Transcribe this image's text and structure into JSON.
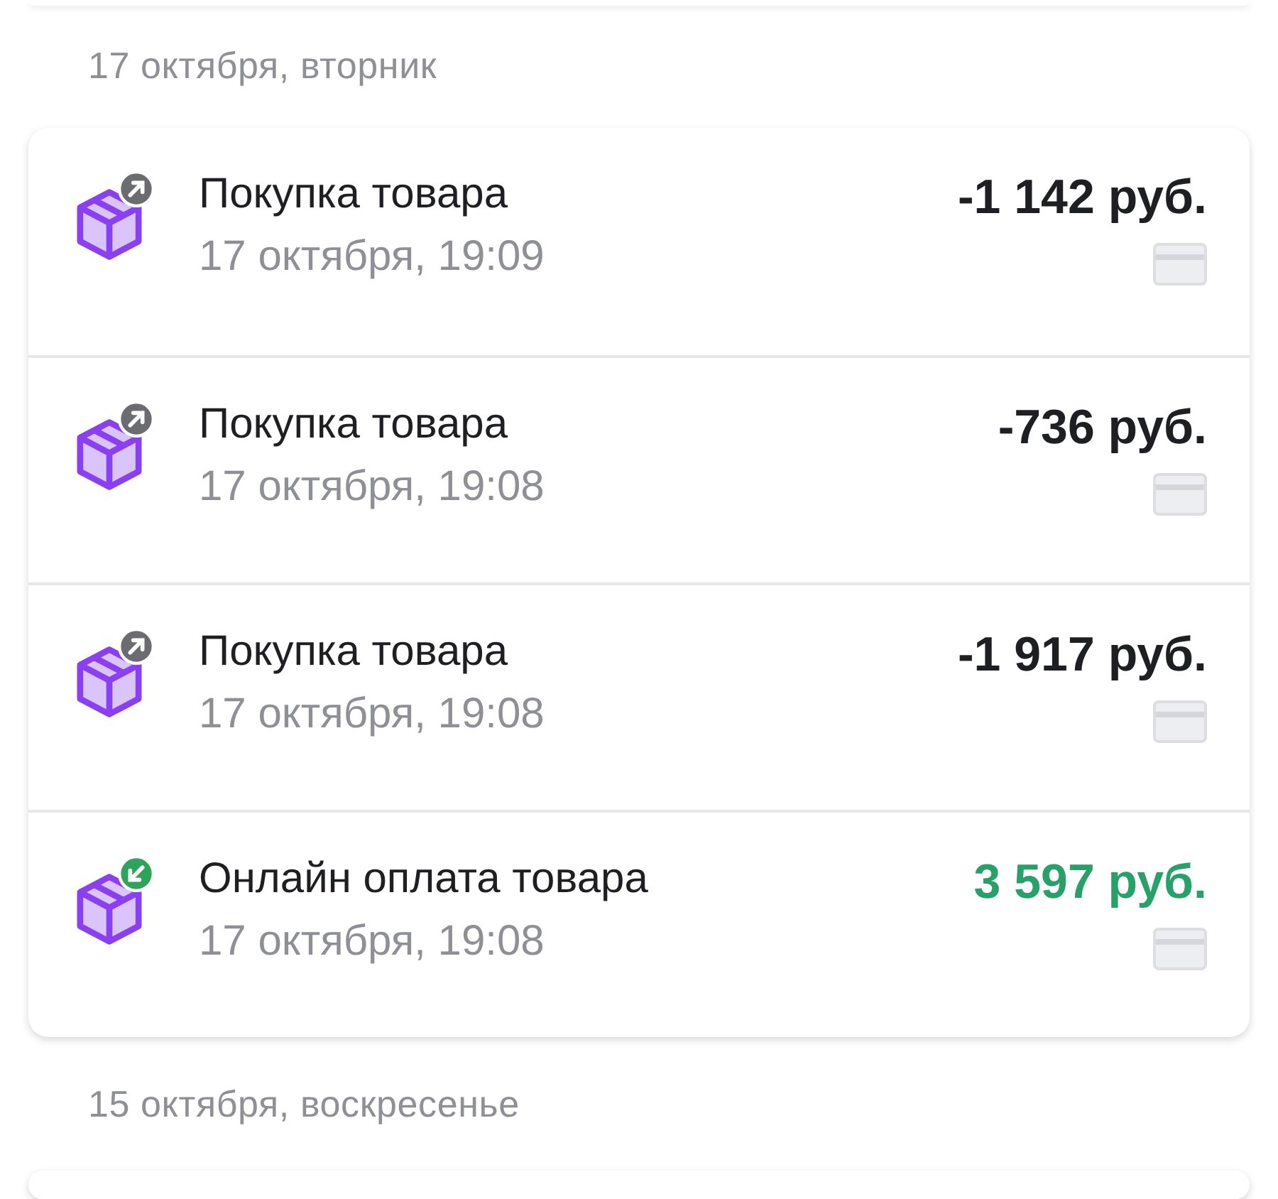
{
  "groups": [
    {
      "date": "17 октября, вторник",
      "transactions": [
        {
          "title": "Покупка товара",
          "time": "17 октября, 19:09",
          "amount": "-1 142 руб.",
          "kind": "outgoing"
        },
        {
          "title": "Покупка товара",
          "time": "17 октября, 19:08",
          "amount": "-736 руб.",
          "kind": "outgoing"
        },
        {
          "title": "Покупка товара",
          "time": "17 октября, 19:08",
          "amount": "-1 917 руб.",
          "kind": "outgoing"
        },
        {
          "title": "Онлайн оплата товара",
          "time": "17 октября, 19:08",
          "amount": "3 597 руб.",
          "kind": "incoming"
        }
      ]
    },
    {
      "date": "15 октября, воскресенье"
    }
  ]
}
